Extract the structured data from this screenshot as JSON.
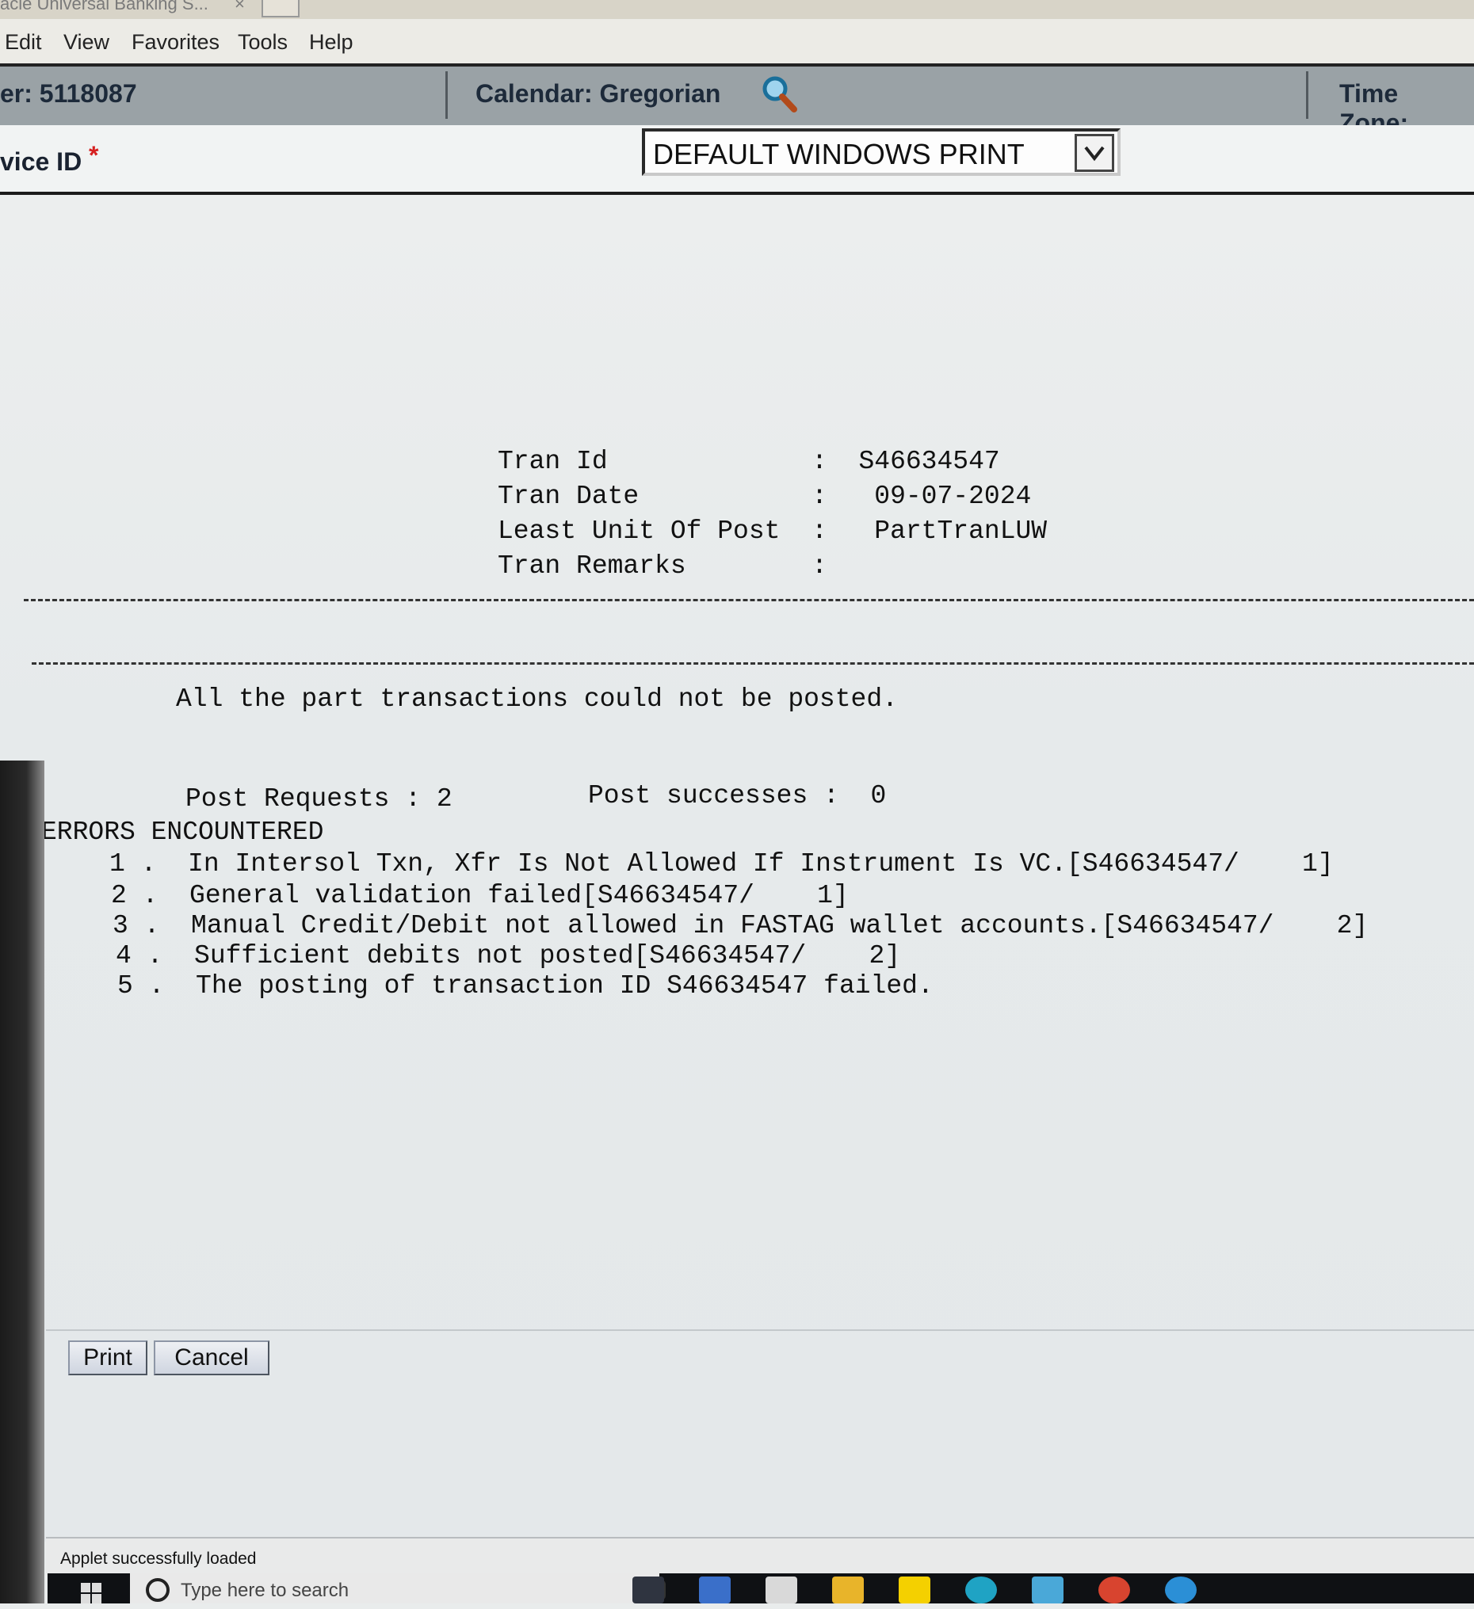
{
  "window": {
    "title": "acle Universal Banking S...",
    "close_glyph": "×"
  },
  "menu": {
    "items": [
      "Edit",
      "View",
      "Favorites",
      "Tools",
      "Help"
    ]
  },
  "infobar": {
    "user_fragment": "er: 5118087",
    "calendar": "Calendar: Gregorian",
    "timezone": "Time Zone:"
  },
  "device": {
    "label": "vice ID",
    "required_mark": "*",
    "selected": "DEFAULT WINDOWS PRINT"
  },
  "report": {
    "tran_id_line": "Tran Id             :  S46634547",
    "tran_date_line": "Tran Date           :   09-07-2024",
    "lup_line": "Least Unit Of Post  :   PartTranLUW",
    "remarks_line": "Tran Remarks        :",
    "message": "All the part transactions could not be posted.",
    "post_requests": "Post Requests : 2",
    "post_successes": "Post successes :  0",
    "errors_heading": "ERRORS ENCOUNTERED",
    "errors": [
      "1 .  In Intersol Txn, Xfr Is Not Allowed If Instrument Is VC.[S46634547/    1]",
      "2 .  General validation failed[S46634547/    1]",
      "3 .  Manual Credit/Debit not allowed in FASTAG wallet accounts.[S46634547/    2]",
      "4 .  Sufficient debits not posted[S46634547/    2]",
      "5 .  The posting of transaction ID S46634547 failed."
    ]
  },
  "buttons": {
    "print": "Print",
    "cancel": "Cancel"
  },
  "status": {
    "text": "Applet successfully loaded"
  },
  "taskbar": {
    "search_placeholder": "Type here to search"
  }
}
